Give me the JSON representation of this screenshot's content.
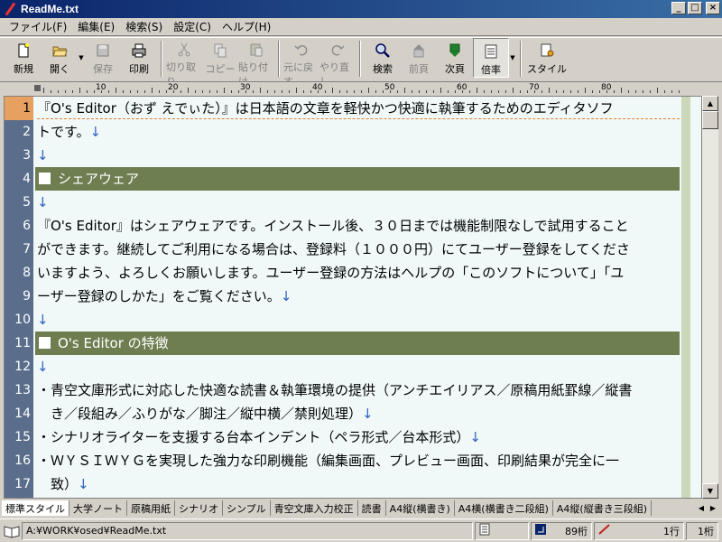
{
  "window": {
    "title": "ReadMe.txt"
  },
  "menu": [
    "ファイル(F)",
    "編集(E)",
    "検索(S)",
    "設定(C)",
    "ヘルプ(H)"
  ],
  "toolbar": [
    {
      "label": "新規",
      "icon": "new-file-icon",
      "enabled": true
    },
    {
      "label": "開く",
      "icon": "open-folder-icon",
      "enabled": true,
      "dropdown": true
    },
    {
      "label": "保存",
      "icon": "save-icon",
      "enabled": false
    },
    {
      "label": "印刷",
      "icon": "print-icon",
      "enabled": true
    },
    {
      "label": "切り取り",
      "icon": "cut-icon",
      "enabled": false
    },
    {
      "label": "コピー",
      "icon": "copy-icon",
      "enabled": false
    },
    {
      "label": "貼り付け",
      "icon": "paste-icon",
      "enabled": false
    },
    {
      "label": "元に戻す",
      "icon": "undo-icon",
      "enabled": false
    },
    {
      "label": "やり直し",
      "icon": "redo-icon",
      "enabled": false
    },
    {
      "label": "検索",
      "icon": "search-icon",
      "enabled": true
    },
    {
      "label": "前頁",
      "icon": "prev-page-icon",
      "enabled": false
    },
    {
      "label": "次頁",
      "icon": "next-page-icon",
      "enabled": true
    },
    {
      "label": "倍率",
      "icon": "zoom-icon",
      "enabled": true,
      "pressed": true,
      "dropdown": true
    },
    {
      "label": "スタイル",
      "icon": "style-icon",
      "enabled": true
    }
  ],
  "ruler": {
    "labels": [
      "10",
      "20",
      "30",
      "40",
      "50",
      "60",
      "70",
      "80"
    ]
  },
  "lines": [
    {
      "n": "1",
      "text": "『O's Editor（おず えでぃた）』は日本語の文章を軽快かつ快適に執筆するためのエディタソフ",
      "arrow": false,
      "heading": false
    },
    {
      "n": "2",
      "text": "トです。",
      "arrow": true,
      "heading": false
    },
    {
      "n": "3",
      "text": "",
      "arrow": true,
      "heading": false
    },
    {
      "n": "4",
      "text": "シェアウェア",
      "arrow": false,
      "heading": true
    },
    {
      "n": "5",
      "text": "",
      "arrow": true,
      "heading": false
    },
    {
      "n": "6",
      "text": "『O's Editor』はシェアウェアです。インストール後、３０日までは機能制限なしで試用すること",
      "arrow": false,
      "heading": false
    },
    {
      "n": "7",
      "text": "ができます。継続してご利用になる場合は、登録料（１０００円）にてユーザー登録をしてくださ",
      "arrow": false,
      "heading": false
    },
    {
      "n": "8",
      "text": "いますよう、よろしくお願いします。ユーザー登録の方法はヘルプの「このソフトについて」「ユ",
      "arrow": false,
      "heading": false
    },
    {
      "n": "9",
      "text": "ーザー登録のしかた」をご覧ください。",
      "arrow": true,
      "heading": false
    },
    {
      "n": "10",
      "text": "",
      "arrow": true,
      "heading": false
    },
    {
      "n": "11",
      "text": "O's Editor の特徴",
      "arrow": false,
      "heading": true
    },
    {
      "n": "12",
      "text": "",
      "arrow": true,
      "heading": false
    },
    {
      "n": "13",
      "text": "・青空文庫形式に対応した快適な読書＆執筆環境の提供（アンチエイリアス／原稿用紙罫線／縦書",
      "arrow": false,
      "heading": false
    },
    {
      "n": "14",
      "text": "　き／段組み／ふりがな／脚注／縦中横／禁則処理）",
      "arrow": true,
      "heading": false
    },
    {
      "n": "15",
      "text": "・シナリオライターを支援する台本インデント（ペラ形式／台本形式）",
      "arrow": true,
      "heading": false
    },
    {
      "n": "16",
      "text": "・ＷＹＳＩＷＹＧを実現した強力な印刷機能（編集画面、プレビュー画面、印刷結果が完全に一",
      "arrow": false,
      "heading": false
    },
    {
      "n": "17",
      "text": "　致）",
      "arrow": true,
      "heading": false
    }
  ],
  "tabs": [
    "標準スタイル",
    "大学ノート",
    "原稿用紙",
    "シナリオ",
    "シンプル",
    "青空文庫入力校正",
    "読書",
    "A4縦(横書き)",
    "A4横(横書き二段組)",
    "A4縦(縦書き三段組)"
  ],
  "status": {
    "path": "A:¥WORK¥osed¥ReadMe.txt",
    "col": "89桁",
    "line": "1行",
    "column": "1桁"
  },
  "colors": {
    "heading_bg": "#6e7e50",
    "gutter_bg": "#5a6e8c",
    "current_line": "#e8a060",
    "arrow": "#3060c0"
  }
}
